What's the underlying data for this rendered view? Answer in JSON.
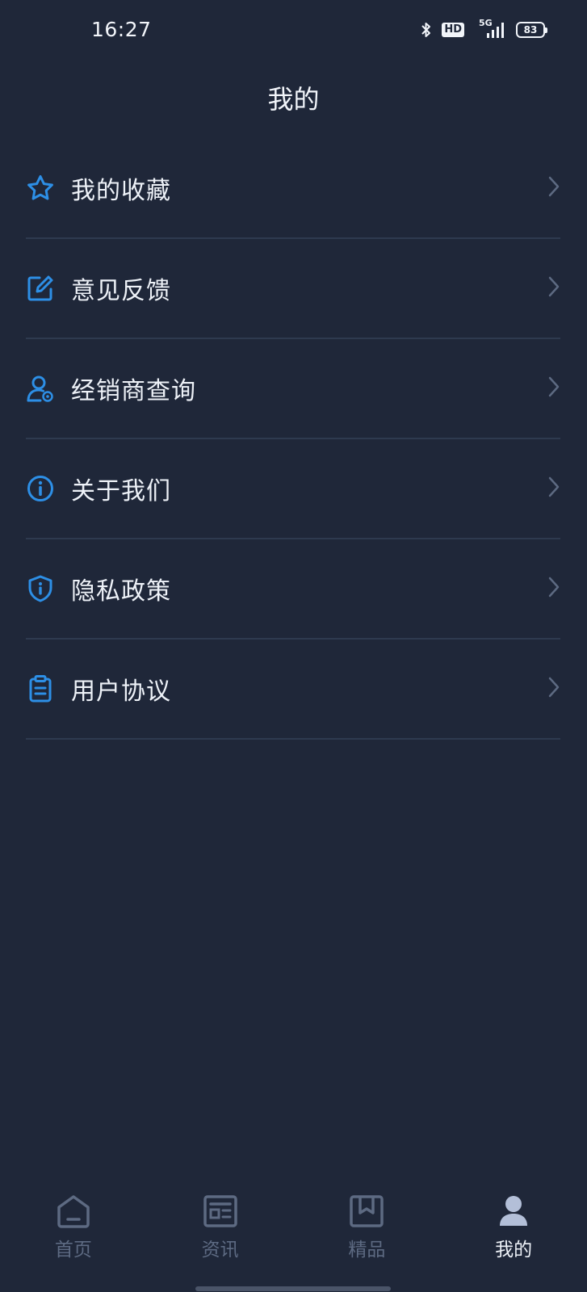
{
  "status_bar": {
    "time": "16:27",
    "hd_label": "HD",
    "network_label": "5G",
    "battery_level": "83"
  },
  "header": {
    "title": "我的"
  },
  "menu": {
    "items": [
      {
        "label": "我的收藏",
        "icon": "star-icon"
      },
      {
        "label": "意见反馈",
        "icon": "edit-icon"
      },
      {
        "label": "经销商查询",
        "icon": "dealer-user-icon"
      },
      {
        "label": "关于我们",
        "icon": "info-icon"
      },
      {
        "label": "隐私政策",
        "icon": "shield-icon"
      },
      {
        "label": "用户协议",
        "icon": "clipboard-icon"
      }
    ]
  },
  "tab_bar": {
    "tabs": [
      {
        "label": "首页",
        "icon": "home-icon",
        "active": false
      },
      {
        "label": "资讯",
        "icon": "news-icon",
        "active": false
      },
      {
        "label": "精品",
        "icon": "bookmark-box-icon",
        "active": false
      },
      {
        "label": "我的",
        "icon": "user-icon",
        "active": true
      }
    ]
  },
  "colors": {
    "background": "#1f2739",
    "accent": "#2d8fe6",
    "divider": "#2e3a4f",
    "tab_inactive": "#5d6a82",
    "text": "#eef2f8"
  }
}
